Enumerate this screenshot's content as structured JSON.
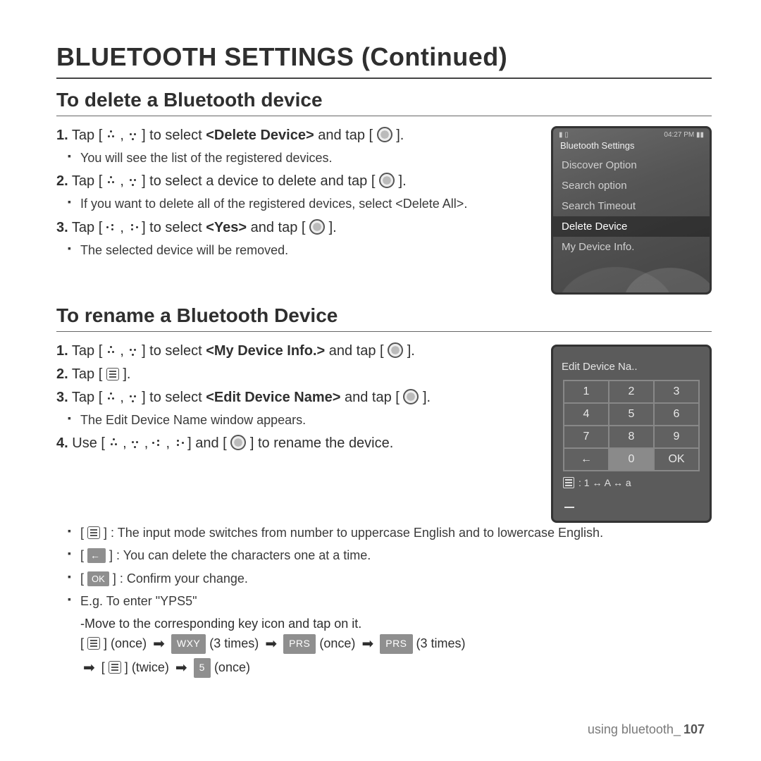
{
  "page_title": "BLUETOOTH SETTINGS (Continued)",
  "section_delete": {
    "heading": "To delete a Bluetooth device",
    "step1_a": "Tap [",
    "step1_b": "] to select ",
    "step1_target": "<Delete Device>",
    "step1_c": " and tap [",
    "step1_d": "].",
    "step1_bullet": "You will see the list of the registered devices.",
    "step2_a": "Tap [",
    "step2_b": "] to select a device to delete and tap [",
    "step2_c": "].",
    "step2_bullet": "If you want to delete all of the registered devices, select <Delete All>.",
    "step3_a": "Tap [",
    "step3_b": "] to select ",
    "step3_target": "<Yes>",
    "step3_c": " and tap [",
    "step3_d": "].",
    "step3_bullet": "The selected device will be removed."
  },
  "device1": {
    "time": "04:27 PM",
    "title": "Bluetooth Settings",
    "rows": [
      "Discover Option",
      "Search option",
      "Search Timeout",
      "Delete Device",
      "My Device Info."
    ],
    "active_index": 3
  },
  "section_rename": {
    "heading": "To rename a Bluetooth Device",
    "step1_a": "Tap [",
    "step1_b": "] to select ",
    "step1_target": "<My Device Info.>",
    "step1_c": " and tap [",
    "step1_d": "].",
    "step2_a": "Tap [",
    "step2_b": "].",
    "step3_a": "Tap [",
    "step3_b": "] to select ",
    "step3_target": "<Edit Device Name>",
    "step3_c": " and tap [",
    "step3_d": "].",
    "step3_bullet": "The Edit Device Name window appears.",
    "step4_a": "Use [",
    "step4_b": "] and [",
    "step4_c": "] to rename the device.",
    "b1": "] : The input mode switches from number to uppercase English and to lowercase English.",
    "b2": "] : You can delete the characters one at a time.",
    "b3": "] : Confirm your change.",
    "eg_intro": "E.g. To enter \"YPS5\"",
    "eg_move": "-Move to the corresponding key icon and tap on it.",
    "seq_once": "(once)",
    "seq_3times": "(3 times)",
    "seq_twice": "(twice)",
    "key_wxy": "WXY",
    "key_prs": "PRS",
    "key_5": "5",
    "key_ok": "OK",
    "key_back": "←"
  },
  "device2": {
    "title": "Edit Device Na..",
    "keys": [
      [
        "1",
        "2",
        "3"
      ],
      [
        "4",
        "5",
        "6"
      ],
      [
        "7",
        "8",
        "9"
      ],
      [
        "←",
        "0",
        "OK"
      ]
    ],
    "active_row": 3,
    "active_col": 1,
    "mode_text": ": 1 ↔ A ↔ a"
  },
  "footer": {
    "label": "using bluetooth_",
    "page": "107"
  }
}
